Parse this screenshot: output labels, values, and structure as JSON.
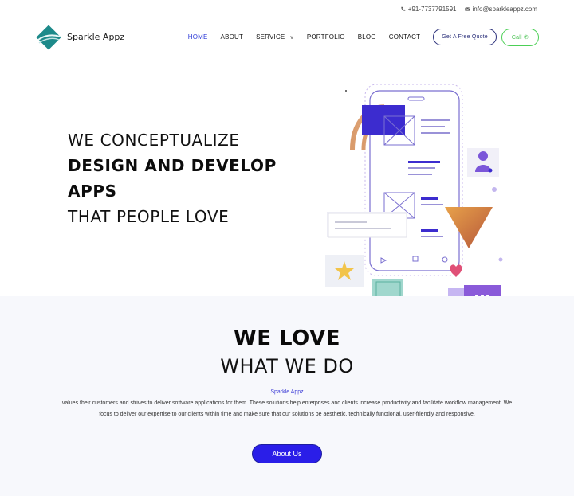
{
  "topbar": {
    "phone": "+91-7737791591",
    "email": "info@sparkleappz.com"
  },
  "brand": {
    "name": "Sparkle Appz"
  },
  "nav": {
    "home": "HOME",
    "about": "ABOUT",
    "service": "SERVICE",
    "portfolio": "PORTFOLIO",
    "blog": "BLOG",
    "contact": "CONTACT",
    "quote_btn": "Get A Free Quote",
    "call_btn": "Call",
    "call_icon": "phone-icon"
  },
  "hero": {
    "line1": "WE CONCEPTUALIZE",
    "line2": "DESIGN AND DEVELOP",
    "line3": "APPS",
    "line4": "THAT PEOPLE LOVE"
  },
  "love": {
    "title_bold": "WE LOVE",
    "title_light": "WHAT WE DO",
    "brand": "Sparkle Appz",
    "description": "values their customers and strives to deliver software applications for them. These solutions help enterprises and clients increase productivity and facilitate workflow management. We focus to deliver our expertise to our clients within time and make sure that our solutions be aesthetic, technically functional, user-friendly and responsive.",
    "button": "About Us"
  },
  "colors": {
    "accent": "#2a1ee8",
    "nav_active": "#2e3bd8",
    "call_green": "#4ccf56",
    "section_bg": "#f7f8fc"
  }
}
